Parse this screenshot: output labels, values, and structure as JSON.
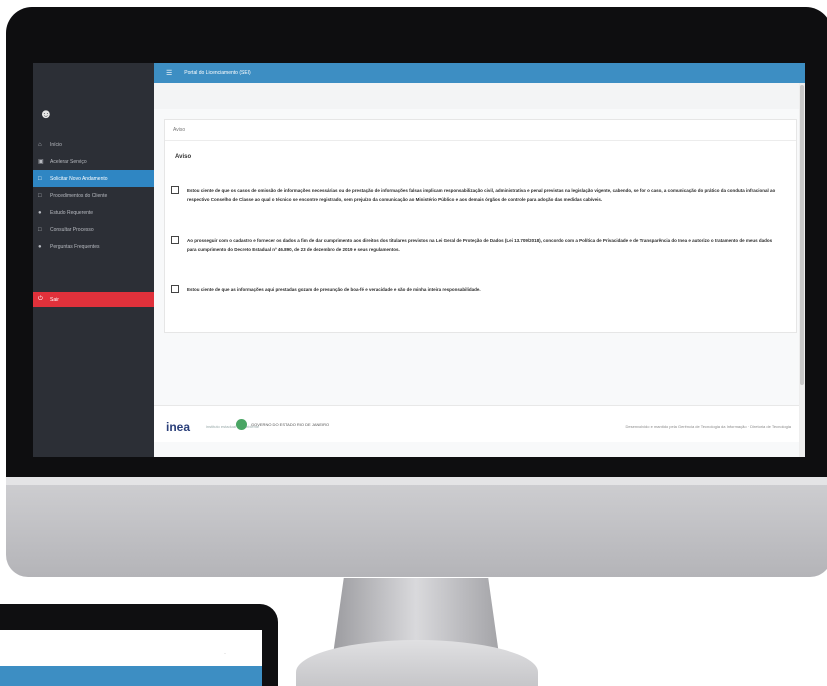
{
  "app": {
    "title": "Portal do Licenciamento (SEI)"
  },
  "sidebar": {
    "avatar_icon": "user-circle-icon",
    "items": [
      {
        "label": "Início",
        "icon": "home-icon",
        "active": false
      },
      {
        "label": "Acelerar Serviço",
        "icon": "bank-icon",
        "active": false
      },
      {
        "label": "Solicitar Novo Andamento",
        "icon": "document-icon",
        "active": true
      },
      {
        "label": "Procedimentos do Cliente",
        "icon": "folder-icon",
        "active": false
      },
      {
        "label": "Estudo Requerente",
        "icon": "users-icon",
        "active": false
      },
      {
        "label": "Consultar Processo",
        "icon": "document-icon",
        "active": false
      },
      {
        "label": "Perguntas Frequentes",
        "icon": "info-icon",
        "active": false
      }
    ],
    "exit_label": "Sair"
  },
  "card": {
    "header": "Aviso",
    "title": "Aviso",
    "checkboxes": [
      {
        "checked": false,
        "text": "Estou ciente de que os casos de omissão de informações necessárias ou de prestação de informações falsas implicam responsabilização civil, administrativa e penal previstas na legislação vigente, cabendo, se for o caso, a comunicação do prático da conduta infracional ao respectivo Conselho de Classe ao qual o técnico se encontre registrado, sem prejuízo da comunicação ao Ministério Público e aos demais órgãos de controle para adoção das medidas cabíveis."
      },
      {
        "checked": false,
        "text": "Ao prosseguir com o cadastro e fornecer os dados a fim de dar cumprimento aos direitos dos titulares previstos na Lei Geral de Proteção de Dados (Lei 13.709/2018), concordo com a Política de Privacidade e de Transparência do Inea e autorizo o tratamento de meus dados para cumprimento do Decreto Estadual nº 46.890, de 23 de dezembro de 2019 e seus regulamentos."
      },
      {
        "checked": false,
        "text": "Estou ciente de que as informações aqui prestadas gozam de presunção de boa-fé e veracidade e são de minha inteira responsabilidade."
      }
    ]
  },
  "footer": {
    "logo": "inea",
    "logo_sub": "instituto estadual do ambiente",
    "gov_text": "GOVERNO DO ESTADO RIO DE JANEIRO",
    "right_text": "Desenvolvido e mantido pela Gerência de Tecnologia da Informação · Diretoria de Tecnologia"
  },
  "colors": {
    "topbar": "#3d8ec3",
    "sidebar": "#2c2f36",
    "active": "#2f86c3",
    "exit": "#e0313b"
  }
}
